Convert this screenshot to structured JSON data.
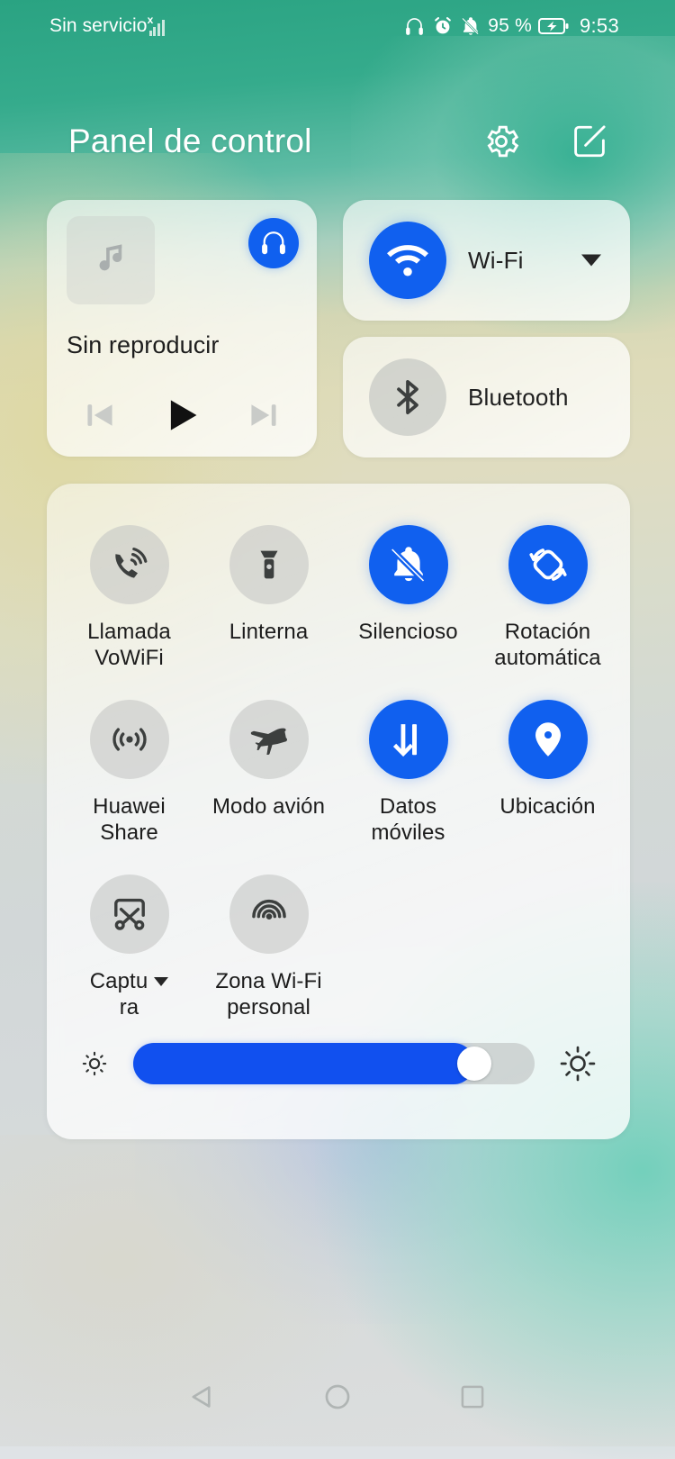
{
  "status_bar": {
    "carrier": "Sin servicio",
    "signal_icon": "signal-no-service-icon",
    "icons": [
      "headphones-icon",
      "alarm-icon",
      "mute-bell-icon"
    ],
    "battery_percent": "95 %",
    "battery_icon": "battery-charging-icon",
    "time": "9:53"
  },
  "header": {
    "title": "Panel de control",
    "settings_icon": "gear-icon",
    "edit_icon": "edit-pencil-icon"
  },
  "media_card": {
    "album_art_icon": "music-note-icon",
    "output_icon": "headphones-icon",
    "title": "Sin reproducir",
    "previous_label": "previous-track-icon",
    "play_label": "play-icon",
    "next_label": "next-track-icon"
  },
  "connectivity": [
    {
      "label": "Wi-Fi",
      "icon": "wifi-icon",
      "active": true,
      "has_caret": true
    },
    {
      "label": "Bluetooth",
      "icon": "bluetooth-icon",
      "active": false,
      "has_caret": false
    }
  ],
  "tiles": [
    {
      "label": "Llamada VoWiFi",
      "icon": "vowifi-call-icon",
      "active": false,
      "has_caret": false
    },
    {
      "label": "Linterna",
      "icon": "flashlight-icon",
      "active": false,
      "has_caret": false
    },
    {
      "label": "Silencioso",
      "icon": "bell-off-icon",
      "active": true,
      "has_caret": false
    },
    {
      "label": "Rotación automática",
      "icon": "auto-rotate-icon",
      "active": true,
      "has_caret": false
    },
    {
      "label": "Huawei Share",
      "icon": "huawei-share-icon",
      "active": false,
      "has_caret": false
    },
    {
      "label": "Modo avión",
      "icon": "airplane-icon",
      "active": false,
      "has_caret": false
    },
    {
      "label": "Datos móviles",
      "icon": "mobile-data-icon",
      "active": true,
      "has_caret": false
    },
    {
      "label": "Ubicación",
      "icon": "location-pin-icon",
      "active": true,
      "has_caret": false
    },
    {
      "label": "Captu ra",
      "label_part_1": "Captu",
      "label_part_2": "ra",
      "icon": "screenshot-icon",
      "active": false,
      "has_caret": true
    },
    {
      "label": "Zona Wi-Fi personal",
      "icon": "hotspot-icon",
      "active": false,
      "has_caret": false
    }
  ],
  "brightness": {
    "low_icon": "brightness-low-icon",
    "high_icon": "brightness-high-icon",
    "value_percent": 85
  },
  "nav_bar": {
    "back": "back-triangle-icon",
    "home": "home-circle-icon",
    "recents": "recents-square-icon"
  },
  "colors": {
    "accent_blue": "#1060ef",
    "inactive_gray": "#c4c6c4",
    "status_text": "#ffffff",
    "label_text": "#1c1c1c"
  }
}
